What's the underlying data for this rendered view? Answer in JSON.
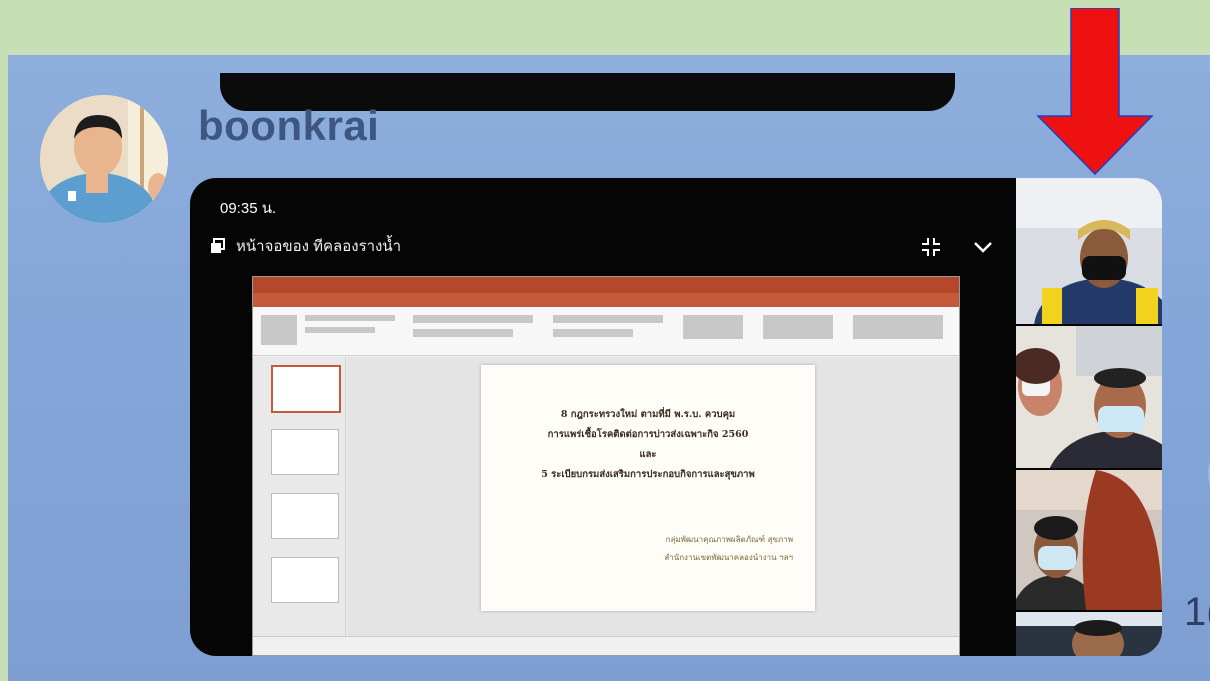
{
  "chat": {
    "sender_name": "boonkrai",
    "edge_partial_text": "1("
  },
  "media": {
    "status_time": "09:35 น.",
    "share_label": "หน้าจอของ ทีคลองรางน้ำ",
    "slide": {
      "line1": "8 กฎกระทรวงใหม่ ตามที่มี พ.ร.บ. ควบคุม",
      "line2": "การแพร่เชื้อโรคติดต่อการบ่าวส่งเฉพาะกิจ 2560",
      "line3": "และ",
      "line4": "5 ระเบียบกรมส่งเสริมการประกอบกิจการและสุขภาพ",
      "credit1": "กลุ่มพัฒนาคุณภาพผลิตภัณฑ์ สุขภาพ",
      "credit2": "สำนักงานเขตพัฒนาคลองนำงาน ฯลฯ"
    }
  },
  "colors": {
    "page_green": "#c6dfb4",
    "chat_blue": "#8eaedc",
    "arrow_red": "#ee1111",
    "username": "#3f5680"
  },
  "icons": [
    "share-screen-icon",
    "fullscreen-icon",
    "chevron-down-icon",
    "red-arrow-annotation"
  ]
}
